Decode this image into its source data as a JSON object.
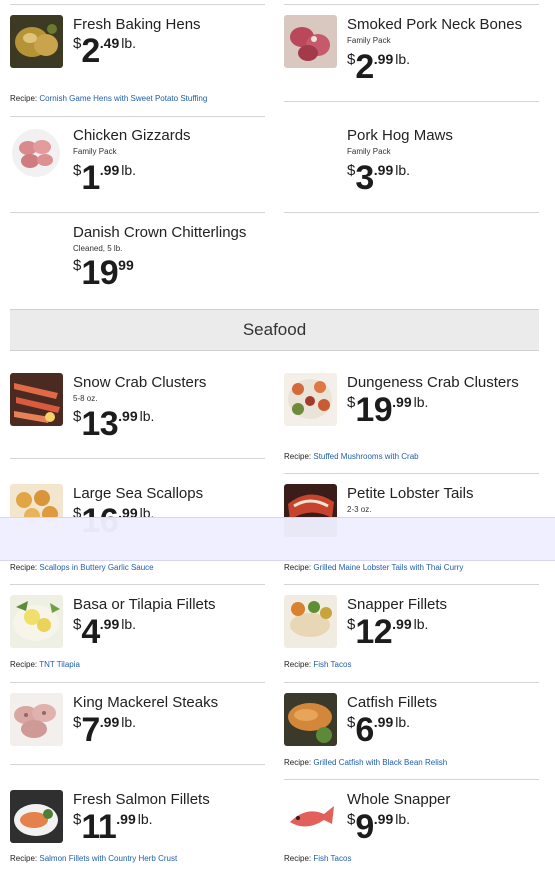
{
  "meat": {
    "baking_hens": {
      "name": "Fresh Baking Hens",
      "dollars": "2",
      "cents": ".49",
      "unit": "lb.",
      "recipe_label": "Recipe:",
      "recipe_link": "Cornish Game Hens with Sweet Potato Stuffing"
    },
    "pork_neck": {
      "name": "Smoked Pork Neck Bones",
      "sub": "Family Pack",
      "dollars": "2",
      "cents": ".99",
      "unit": "lb."
    },
    "gizzards": {
      "name": "Chicken Gizzards",
      "sub": "Family Pack",
      "dollars": "1",
      "cents": ".99",
      "unit": "lb."
    },
    "hog_maws": {
      "name": "Pork Hog Maws",
      "sub": "Family Pack",
      "dollars": "3",
      "cents": ".99",
      "unit": "lb."
    },
    "chitterlings": {
      "name": "Danish Crown Chitterlings",
      "sub": "Cleaned, 5 lb.",
      "dollars": "19",
      "cents": "99"
    }
  },
  "seafood": {
    "section_title": "Seafood",
    "snow_crab": {
      "name": "Snow Crab Clusters",
      "sub": "5-8 oz.",
      "dollars": "13",
      "cents": ".99",
      "unit": "lb."
    },
    "dungeness": {
      "name": "Dungeness Crab Clusters",
      "dollars": "19",
      "cents": ".99",
      "unit": "lb.",
      "recipe_label": "Recipe:",
      "recipe_link": "Stuffed Mushrooms with Crab"
    },
    "scallops": {
      "name": "Large Sea Scallops",
      "dollars": "16",
      "cents": ".99",
      "unit": "lb.",
      "recipe_label": "Recipe:",
      "recipe_link": "Scallops in Buttery Garlic Sauce"
    },
    "lobster": {
      "name": "Petite Lobster Tails",
      "sub": "2-3 oz.",
      "recipe_label": "Recipe:",
      "recipe_link": "Grilled Maine Lobster Tails with Thai Curry"
    },
    "basa": {
      "name": "Basa or Tilapia Fillets",
      "dollars": "4",
      "cents": ".99",
      "unit": "lb.",
      "recipe_label": "Recipe:",
      "recipe_link": "TNT Tilapia"
    },
    "snapper_fillets": {
      "name": "Snapper Fillets",
      "dollars": "12",
      "cents": ".99",
      "unit": "lb.",
      "recipe_label": "Recipe:",
      "recipe_link": "Fish Tacos"
    },
    "mackerel": {
      "name": "King Mackerel Steaks",
      "dollars": "7",
      "cents": ".99",
      "unit": "lb."
    },
    "catfish": {
      "name": "Catfish Fillets",
      "dollars": "6",
      "cents": ".99",
      "unit": "lb.",
      "recipe_label": "Recipe:",
      "recipe_link": "Grilled Catfish with Black Bean Relish"
    },
    "salmon": {
      "name": "Fresh Salmon Fillets",
      "dollars": "11",
      "cents": ".99",
      "unit": "lb.",
      "recipe_label": "Recipe:",
      "recipe_link": "Salmon Fillets with Country Herb Crust"
    },
    "whole_snapper": {
      "name": "Whole Snapper",
      "dollars": "9",
      "cents": ".99",
      "unit": "lb.",
      "recipe_label": "Recipe:",
      "recipe_link": "Fish Tacos"
    }
  },
  "currency_symbol": "$",
  "colors": {
    "link": "#1f5fa8",
    "header_bg": "#ebebeb",
    "overlay_bg": "#eeeeff"
  }
}
